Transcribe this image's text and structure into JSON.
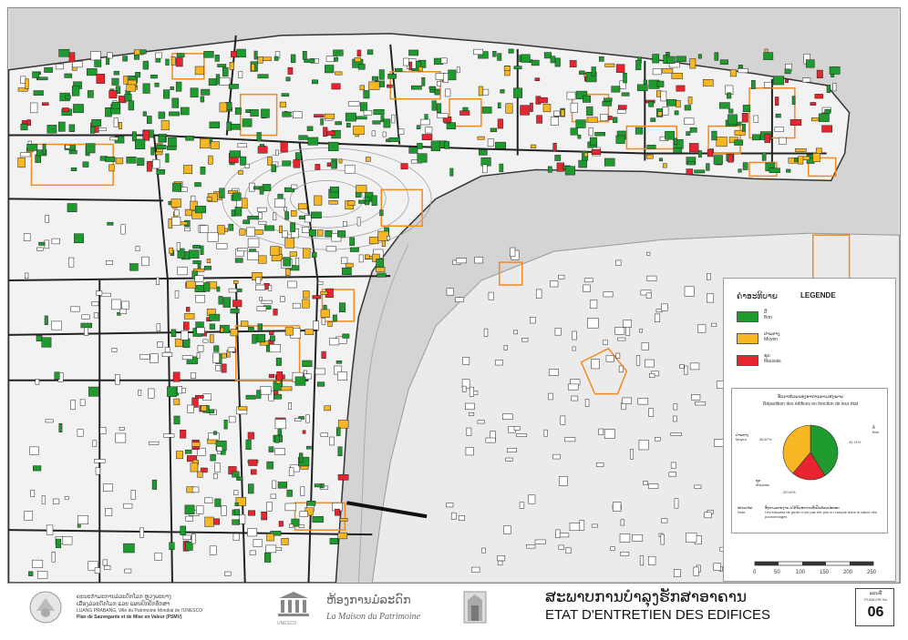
{
  "legend": {
    "lao_title": "ຄຳອະທິບາຍ",
    "title": "LEGENDE",
    "items": [
      {
        "lao": "ດີ",
        "fr": "Bon",
        "color": "#1f9a2f"
      },
      {
        "lao": "ປານກາງ",
        "fr": "Moyen",
        "color": "#f6b723"
      },
      {
        "lao": "ຊຸດ",
        "fr": "Mauvais",
        "color": "#e8252f"
      }
    ]
  },
  "chart_data": {
    "type": "pie",
    "title_lao": "ອັດຕາສ່ວນຂອງອາຄານຕາມສະພາບ",
    "title": "Répartition des édifices en fonction de leur état",
    "slices": [
      {
        "label_lao": "ດີ",
        "label": "Bon",
        "value": 41.11,
        "value_text": "41.11%",
        "color": "#1f9a2f"
      },
      {
        "label_lao": "ຊຸດ",
        "label": "Mauvais",
        "value": 20.02,
        "value_text": "20.02%",
        "color": "#e8252f"
      },
      {
        "label_lao": "ປານກາງ",
        "label": "Moyen",
        "value": 38.87,
        "value_text": "38.87%",
        "color": "#f6b723"
      }
    ],
    "note_label_lao": "ໝາຍເຫດ",
    "note_label": "Note",
    "note_lao": "ອີງຕາມລາຍງານ ບໍ່ໄດ້ນັບອາຄານທີ່ເປັນສ່ວນປະກອບ",
    "note": "Les édicules de jardin n'ont pas été pris en compte dans le calcul des pourcentages"
  },
  "scale": {
    "ticks": [
      "0",
      "50",
      "100",
      "150",
      "200",
      "250"
    ]
  },
  "footer": {
    "lao_line1": "ຄະນະກຳມະການມໍລະດົກໂລກ ຫຼວງພະບາງ",
    "lao_line2": "ເມືອງມໍລະດົກໂລກ ແລະ ແຜນປົກປັກຮັກສາ",
    "org_line1": "LUANG PRABANG, Ville du Patrimoine Mondial de l'UNESCO",
    "org_line2": "Plan de Sauvegarde et de Mise en Valeur (PSMV)",
    "unesco_label": "UNESCO",
    "maison_lao": "ຫ້ອງການມໍລະດົກ",
    "maison_fr": "La Maison du Patrimoine",
    "title_lao": "ສະພາບການບຳລຸງຮັກສາອາຄານ",
    "title_fr": "ETAT D'ENTRETIEN DES EDIFICES",
    "plate_lao": "ແຜນທີ່",
    "plate_label": "PLANCHE No",
    "plate_number": "06"
  },
  "colors": {
    "bon": "#1f9a2f",
    "moyen": "#f6b723",
    "mauvais": "#e8252f",
    "zone": "#f08a24",
    "river": "#d0d0d0",
    "land": "#f4f4f4"
  }
}
